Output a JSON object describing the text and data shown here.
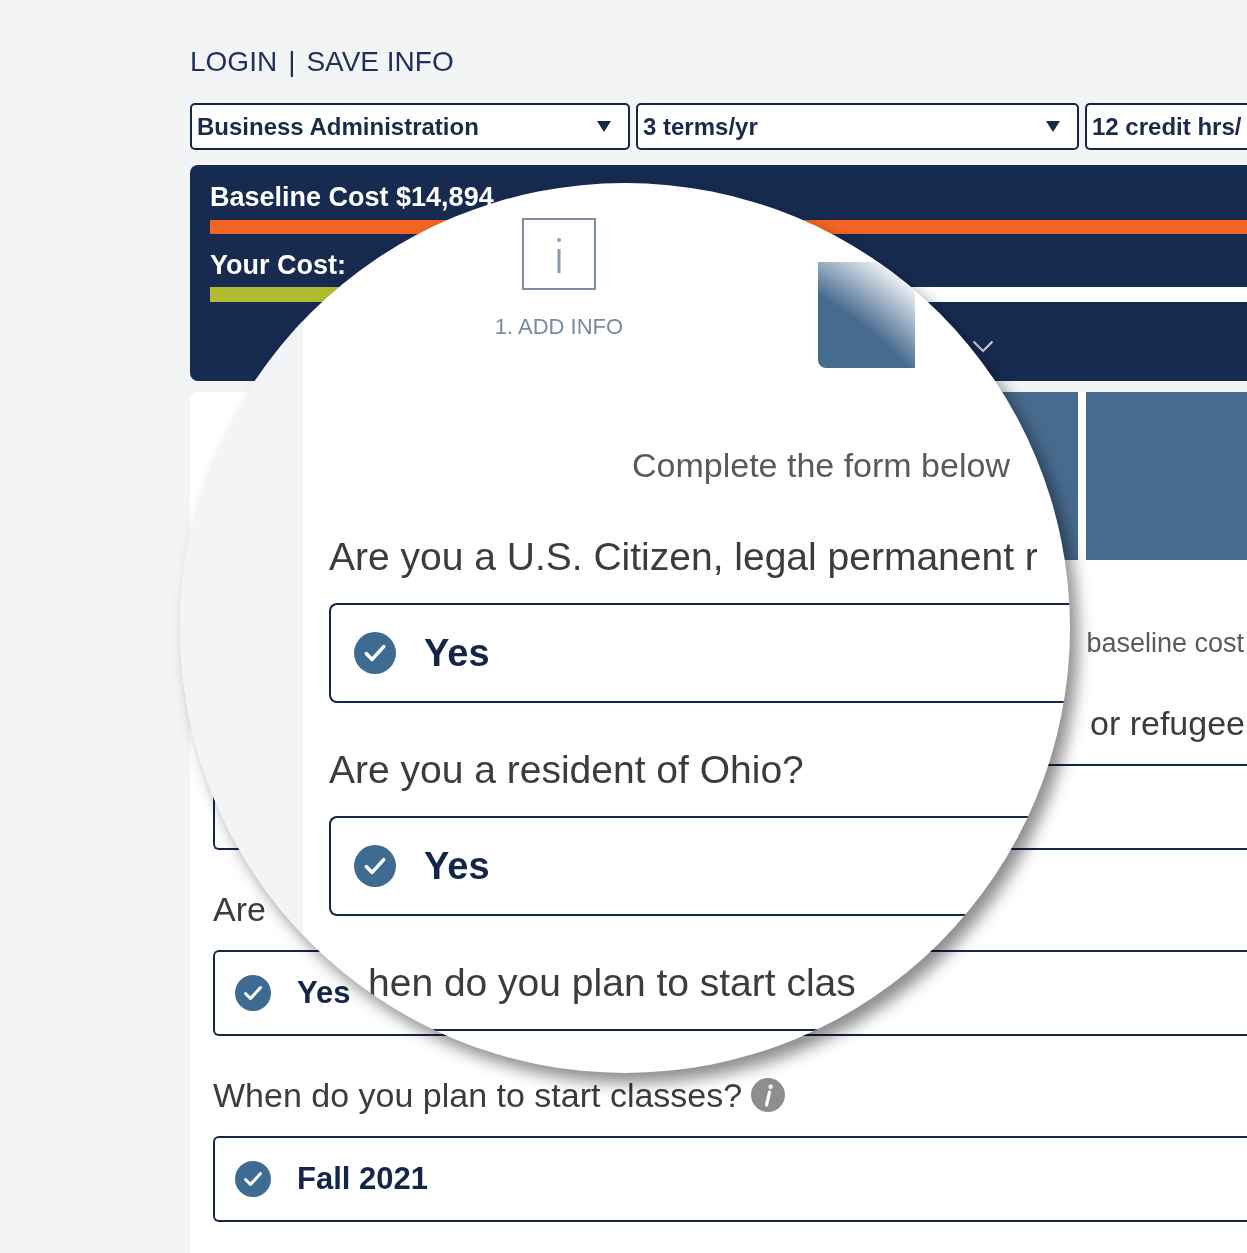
{
  "header": {
    "links": [
      {
        "label": "LOGIN"
      },
      {
        "label": "SAVE INFO"
      }
    ],
    "separator": "|"
  },
  "selects": [
    {
      "value": "Business Administration",
      "caret": true
    },
    {
      "value": "3 terms/yr",
      "caret": true
    },
    {
      "value": "12 credit hrs/",
      "caret": false
    }
  ],
  "cost_panel": {
    "bars": [
      {
        "label": "Baseline Cost $14,894",
        "level": 1,
        "color": "#f26522"
      },
      {
        "label": "Your Cost:",
        "level": 0.14,
        "color": "#b1bc33"
      }
    ]
  },
  "form": {
    "steps": [
      {
        "selected": false
      },
      {
        "selected": false
      }
    ],
    "intro": "baseline cost",
    "questions": [
      {
        "kind": "tail",
        "text": "or refugee"
      },
      {
        "kind": "head",
        "text": "Are",
        "answer": "Yes",
        "checked": true
      },
      {
        "kind": "whole",
        "text": "When do you plan to start classes?",
        "info": true,
        "answer": "Fall 2021",
        "checked": true
      }
    ]
  },
  "lens": {
    "steps": [
      {
        "label": "1. ADD INFO",
        "selected": true
      },
      {
        "selected": false
      }
    ],
    "intro": "Complete the form below",
    "questions": [
      {
        "kind": "head",
        "text": "Are you a U.S. Citizen, legal permanent r",
        "answer": "Yes",
        "checked": true
      },
      {
        "kind": "whole",
        "text": "Are you a resident of Ohio?",
        "answer": "Yes",
        "checked": true
      },
      {
        "kind": "middle",
        "text": "hen do you plan to start clas"
      }
    ]
  }
}
